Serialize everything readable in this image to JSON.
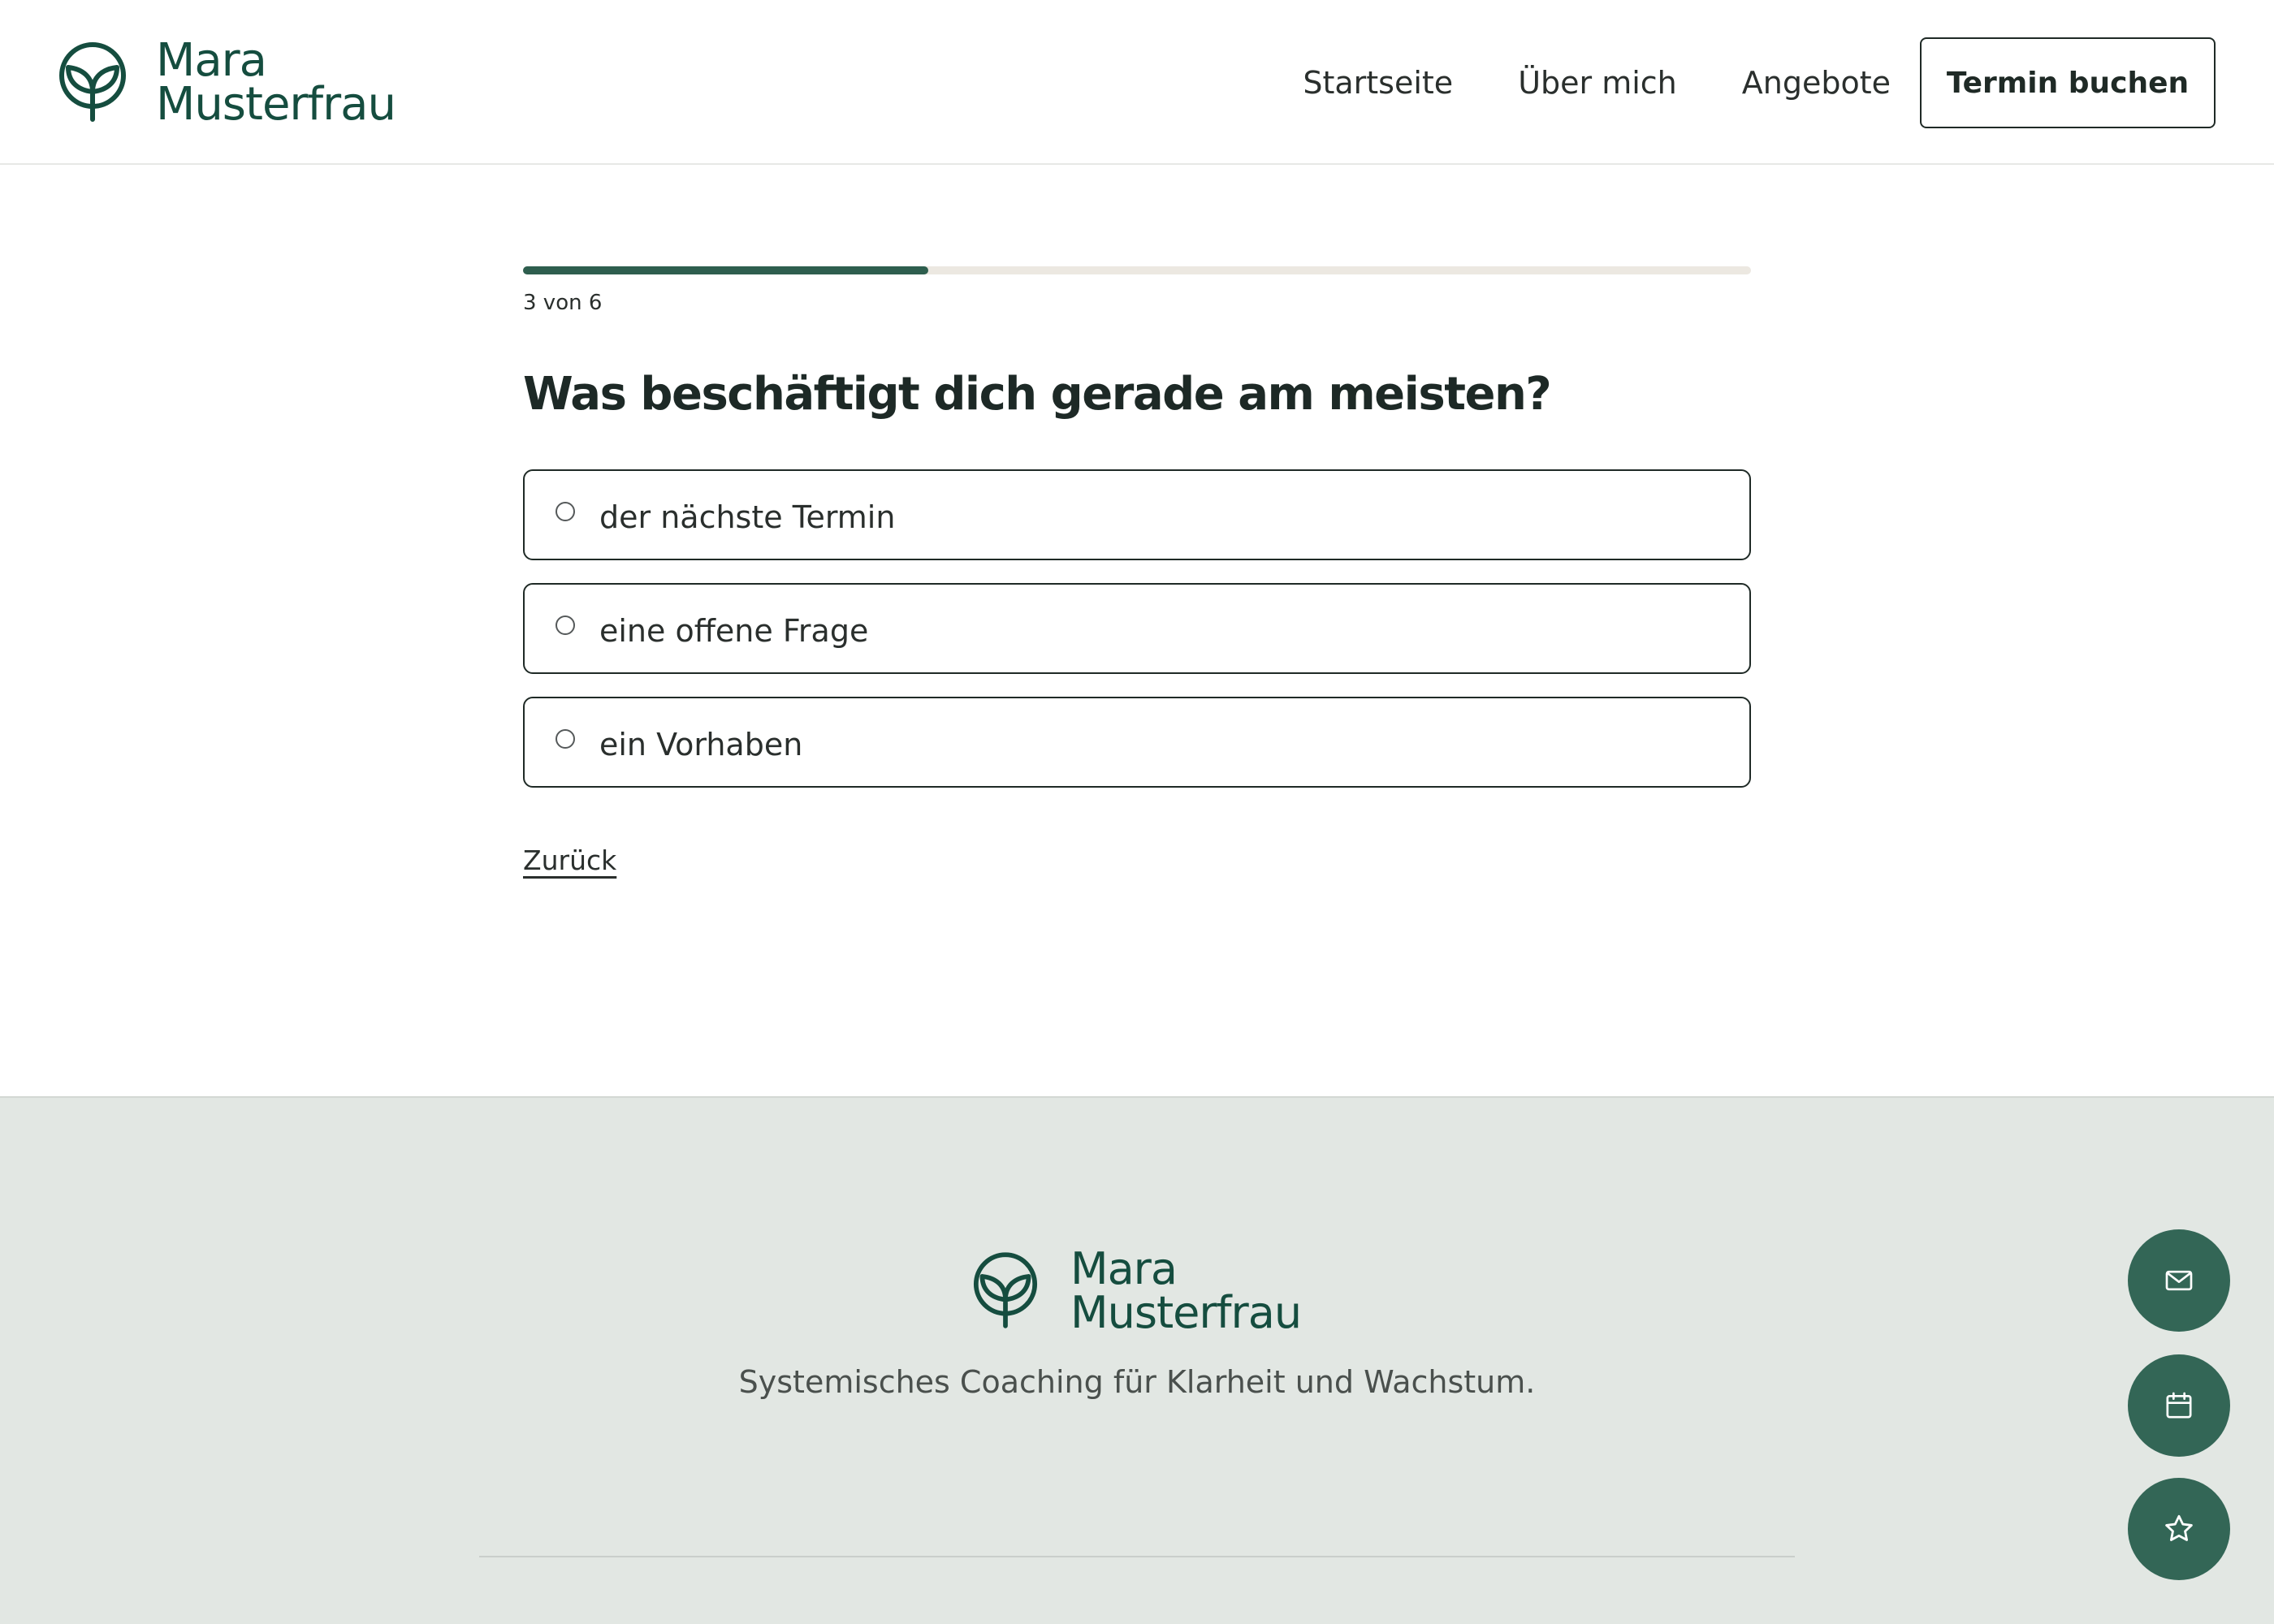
{
  "brand": {
    "name_line1": "Mara",
    "name_line2": "Musterfrau",
    "color": "#154d3f"
  },
  "nav": {
    "items": [
      {
        "label": "Startseite"
      },
      {
        "label": "Über mich"
      },
      {
        "label": "Angebote"
      }
    ],
    "cta_label": "Termin buchen"
  },
  "quiz": {
    "progress": {
      "current": 3,
      "total": 6,
      "label": "3 von 6",
      "fill_fraction": 0.33
    },
    "question": "Was beschäftigt dich gerade am meisten?",
    "options": [
      {
        "label": "der nächste Termin",
        "selected": false
      },
      {
        "label": "eine offene Frage",
        "selected": false
      },
      {
        "label": "ein Vorhaben",
        "selected": false
      }
    ],
    "back_label": "Zurück"
  },
  "footer": {
    "tagline": "Systemisches Coaching für Klarheit und Wachstum."
  },
  "floating_actions": [
    {
      "icon": "mail-icon"
    },
    {
      "icon": "calendar-icon"
    },
    {
      "icon": "star-icon"
    }
  ],
  "colors": {
    "accent": "#2e5e4e",
    "fab": "#336656",
    "footer_bg": "#e2e7e3",
    "progress_track": "#ece8e1"
  }
}
